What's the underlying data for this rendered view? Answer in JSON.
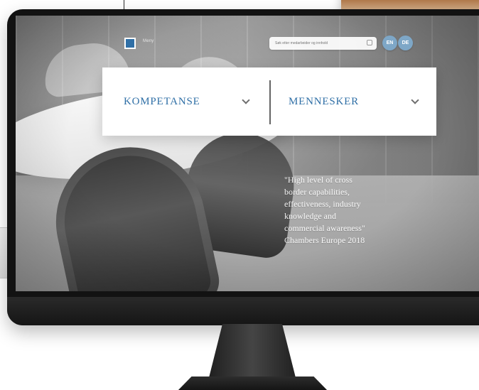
{
  "header": {
    "menu_label": "Meny"
  },
  "search": {
    "placeholder": "Søk etter medarbeider og innhold"
  },
  "languages": {
    "en": "EN",
    "de": "DE"
  },
  "panel": {
    "left_title": "KOMPETANSE",
    "right_title": "MENNESKER"
  },
  "quote": {
    "text": "\"High level of cross\nborder capabilities,\neffectiveness, industry\nknowledge and\ncommercial awareness\"\nChambers Europe 2018"
  },
  "colors": {
    "accent_blue": "#2f6fa6",
    "lang_circle": "#7ea7c7",
    "panel_bg": "#ffffff"
  },
  "icons": {
    "menu": "menu-icon",
    "search": "search-icon",
    "chevron": "chevron-down-icon"
  }
}
